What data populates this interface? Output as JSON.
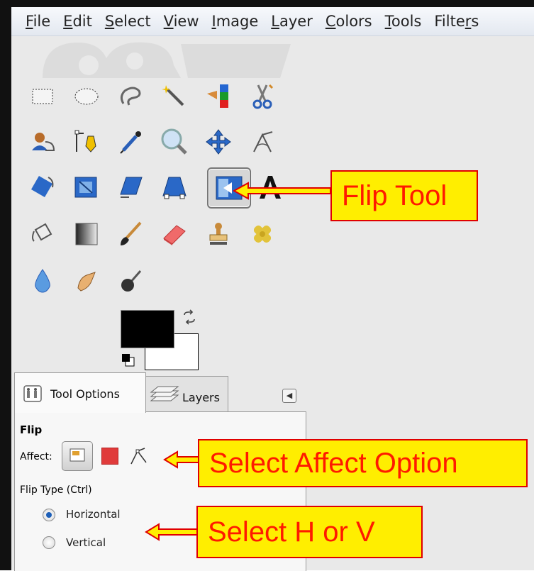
{
  "menubar": {
    "items": [
      "File",
      "Edit",
      "Select",
      "View",
      "Image",
      "Layer",
      "Colors",
      "Tools",
      "Filters"
    ],
    "mnemonics": [
      "F",
      "E",
      "S",
      "V",
      "I",
      "L",
      "C",
      "T",
      "r"
    ]
  },
  "toolbox": {
    "rows": [
      [
        "rect-select-icon",
        "ellipse-select-icon",
        "free-select-icon",
        "fuzzy-select-icon",
        "select-by-color-icon",
        "scissors-select-icon"
      ],
      [
        "foreground-select-icon",
        "paths-icon",
        "color-picker-icon",
        "zoom-icon",
        "move-icon",
        "measure-icon"
      ],
      [
        "rotate-icon",
        "scale-icon",
        "shear-icon",
        "perspective-icon",
        "flip-icon",
        "text-icon"
      ],
      [
        "bucket-fill-icon",
        "blend-icon",
        "paintbrush-icon",
        "eraser-icon",
        "clone-icon",
        "heal-icon"
      ],
      [
        "blur-icon",
        "smudge-icon",
        "dodge-burn-icon"
      ]
    ],
    "active_tool": "flip-icon"
  },
  "colors": {
    "foreground": "#000000",
    "background": "#ffffff"
  },
  "tabs": {
    "tool_options": "Tool Options",
    "layers": "Layers"
  },
  "tool_options": {
    "title": "Flip",
    "affect_label": "Affect:",
    "flip_type_label": "Flip Type  (Ctrl)",
    "options": [
      {
        "label": "Horizontal",
        "checked": true
      },
      {
        "label": "Vertical",
        "checked": false
      }
    ]
  },
  "callouts": {
    "flip_tool": "Flip Tool",
    "affect": "Select Affect Option",
    "h_or_v": "Select H or V"
  },
  "accent_colors": {
    "callout_fill": "#ffee00",
    "callout_text": "#ff1a00",
    "radio_checked": "#1d5fb8"
  }
}
